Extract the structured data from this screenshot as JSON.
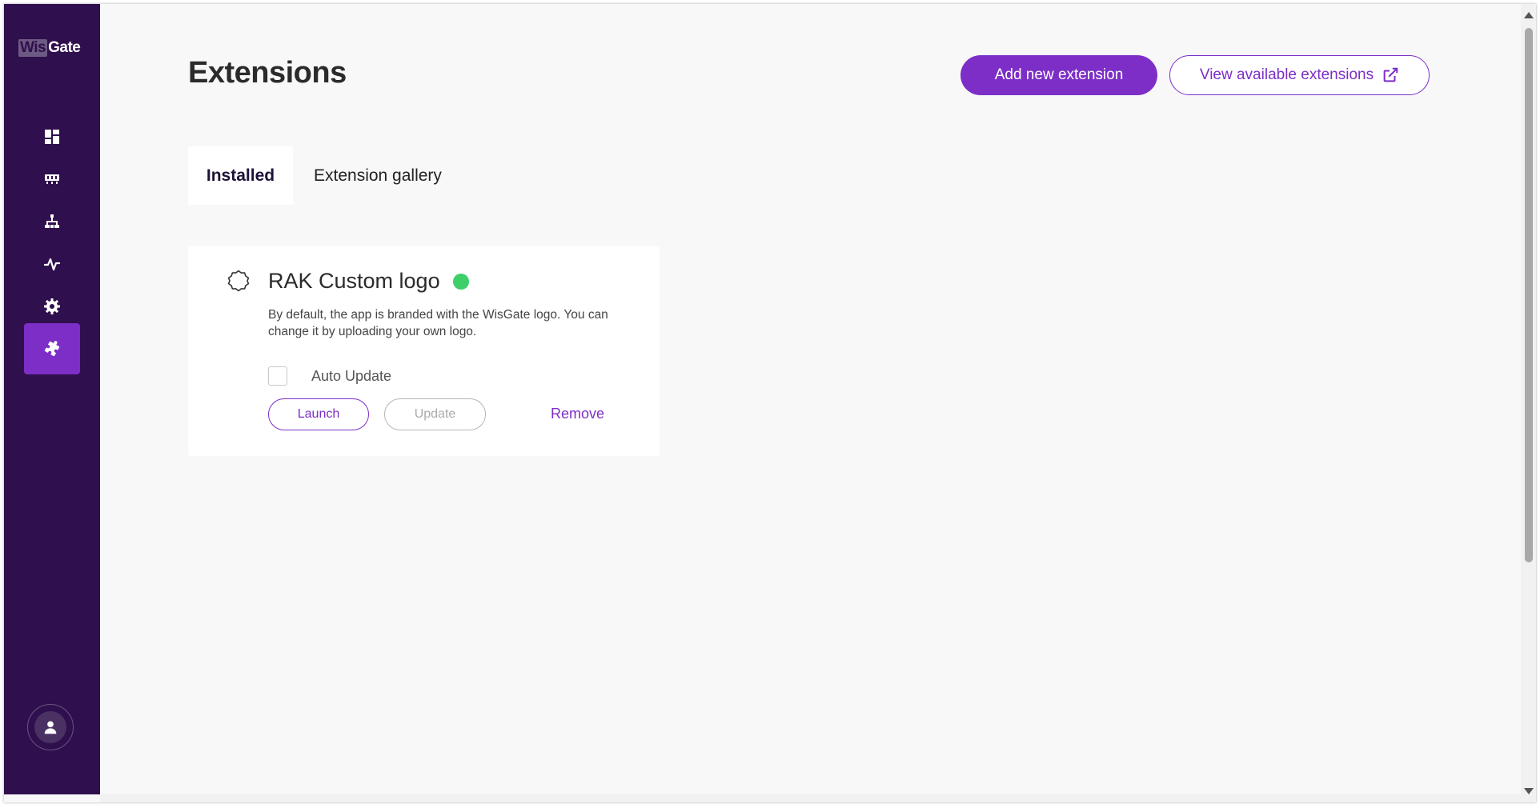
{
  "app": {
    "logo_part1": "Wis",
    "logo_part2": "Gate"
  },
  "sidebar": {
    "items": [
      {
        "icon": "dashboard-icon",
        "active": false
      },
      {
        "icon": "gateway-icon",
        "active": false
      },
      {
        "icon": "network-icon",
        "active": false
      },
      {
        "icon": "activity-icon",
        "active": false
      },
      {
        "icon": "settings-icon",
        "active": false
      },
      {
        "icon": "extensions-icon",
        "active": true
      }
    ],
    "user_icon": "user-icon"
  },
  "header": {
    "title": "Extensions",
    "add_button": "Add new extension",
    "view_button": "View available extensions"
  },
  "tabs": [
    {
      "label": "Installed",
      "active": true
    },
    {
      "label": "Extension gallery",
      "active": false
    }
  ],
  "extensions": [
    {
      "name": "RAK Custom logo",
      "status": "active",
      "status_color": "#3ecf6a",
      "description": "By default, the app is branded with the WisGate logo. You can change it by uploading your own logo.",
      "auto_update_label": "Auto Update",
      "auto_update_checked": false,
      "launch_label": "Launch",
      "update_label": "Update",
      "remove_label": "Remove"
    }
  ],
  "colors": {
    "accent": "#7c2ec7",
    "sidebar": "#2f0f4d",
    "background": "#f8f8f8"
  }
}
